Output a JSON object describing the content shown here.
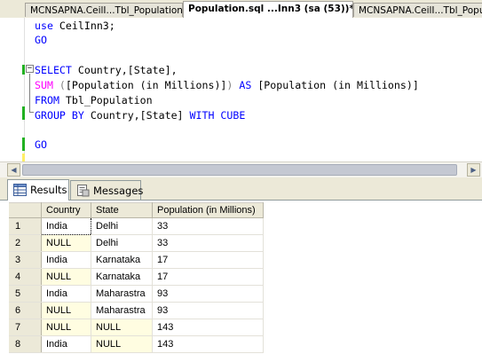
{
  "tabs": [
    {
      "label": "MCNSAPNA.CeilI...Tbl_Population",
      "active": false
    },
    {
      "label": "Population.sql ...Inn3 (sa (53))*",
      "active": true
    },
    {
      "label": "MCNSAPNA.CeilI...Tbl_Population",
      "active": false
    }
  ],
  "editor": {
    "line1": {
      "kw": "use",
      "rest": " CeilInn3;"
    },
    "line2": {
      "kw": "GO"
    },
    "line3": {
      "kw": "SELECT",
      "rest": " Country,[State],"
    },
    "line4": {
      "fn": "SUM",
      "open": " (",
      "inner": "[Population (in Millions)]",
      "close": ")",
      "kw": " AS",
      "rest": " [Population (in Millions)]"
    },
    "line5": {
      "kw": "FROM",
      "rest": " Tbl_Population"
    },
    "line6": {
      "kw1": "GROUP BY",
      "rest": " Country,[State]",
      "kw2": " WITH CUBE"
    },
    "line7": {
      "kw": "GO"
    }
  },
  "results_tabs": {
    "results": "Results",
    "messages": "Messages"
  },
  "grid": {
    "columns": [
      "Country",
      "State",
      "Population (in Millions)"
    ],
    "rows": [
      {
        "n": "1",
        "country": "India",
        "state": "Delhi",
        "pop": "33"
      },
      {
        "n": "2",
        "country": "NULL",
        "state": "Delhi",
        "pop": "33"
      },
      {
        "n": "3",
        "country": "India",
        "state": "Karnataka",
        "pop": "17"
      },
      {
        "n": "4",
        "country": "NULL",
        "state": "Karnataka",
        "pop": "17"
      },
      {
        "n": "5",
        "country": "India",
        "state": "Maharastra",
        "pop": "93"
      },
      {
        "n": "6",
        "country": "NULL",
        "state": "Maharastra",
        "pop": "93"
      },
      {
        "n": "7",
        "country": "NULL",
        "state": "NULL",
        "pop": "143"
      },
      {
        "n": "8",
        "country": "India",
        "state": "NULL",
        "pop": "143"
      }
    ]
  },
  "colors": {
    "keyword": "#0000ff",
    "function": "#ff00ff",
    "changed_marker": "#21b121",
    "saved_marker": "#ffee66",
    "null_cell": "#fffde1"
  }
}
